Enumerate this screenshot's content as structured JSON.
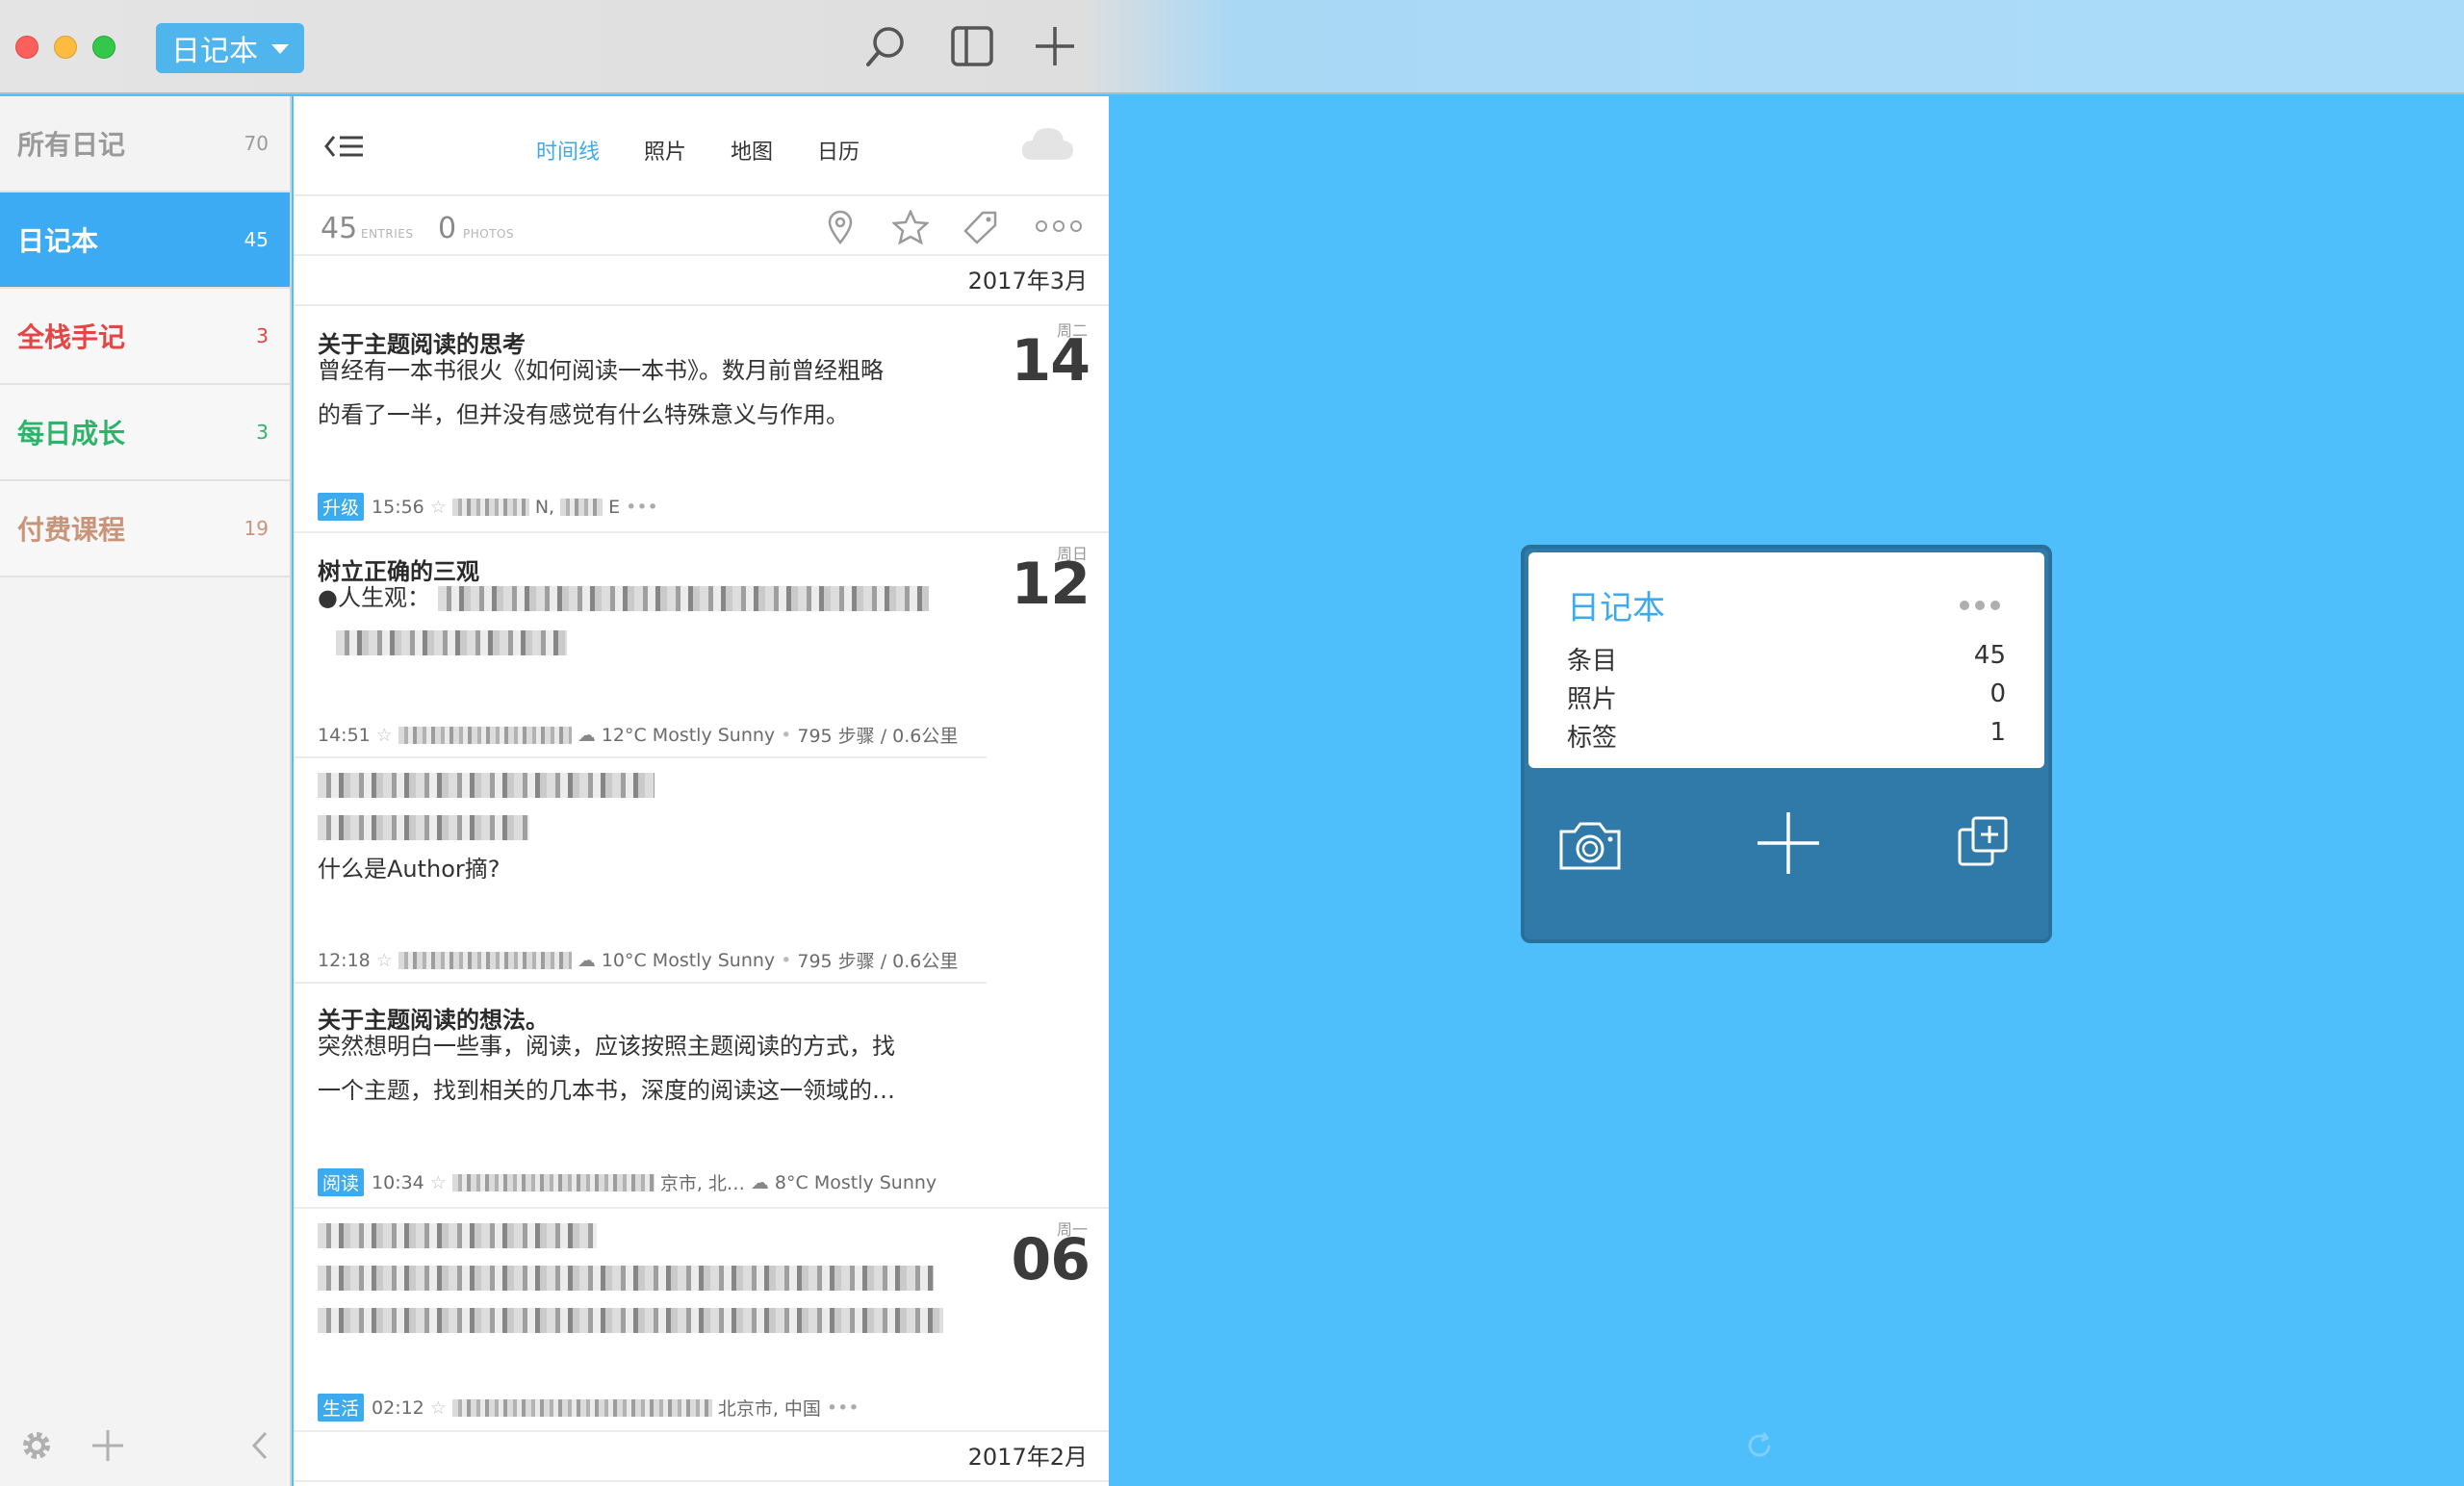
{
  "titlebar": {
    "journal_picker": "日记本",
    "icons": [
      "search-icon",
      "sidebar-toggle-icon",
      "add-icon"
    ]
  },
  "sidebar": {
    "items": [
      {
        "label": "所有日记",
        "count": "70",
        "color": "#9a9a9a"
      },
      {
        "label": "日记本",
        "count": "45",
        "color": "#3cabf3"
      },
      {
        "label": "全栈手记",
        "count": "3",
        "color": "#e54545"
      },
      {
        "label": "每日成长",
        "count": "3",
        "color": "#2fb36a"
      },
      {
        "label": "付费课程",
        "count": "19",
        "color": "#c9957a"
      }
    ],
    "footer_icons": [
      "gear-icon",
      "add-icon",
      "chevron-left-icon"
    ]
  },
  "list": {
    "tabs": [
      "时间线",
      "照片",
      "地图",
      "日历"
    ],
    "active_tab": "时间线",
    "stats": {
      "entries": "45",
      "entries_label": "ENTRIES",
      "photos": "0",
      "photos_label": "PHOTOS"
    },
    "filter_icons": [
      "location-pin-icon",
      "star-icon",
      "tag-icon",
      "more-icon"
    ],
    "month_top": "2017年3月",
    "month_bottom": "2017年2月",
    "entries": [
      {
        "title": "关于主题阅读的思考",
        "body1": "曾经有一本书很火《如何阅读一本书》。数月前曾经粗略",
        "body2": "的看了一半，但并没有感觉有什么特殊意义与作用。",
        "tag": "升级",
        "time": "15:56",
        "meta_tail": "N,",
        "meta_tail2": "E",
        "dow": "周二",
        "day": "14"
      },
      {
        "title": "树立正确的三观",
        "body1": "●人生观：",
        "time": "14:51",
        "weather": "12°C Mostly Sunny",
        "steps": "795 步骤 / 0.6公里",
        "dow": "周日",
        "day": "12"
      },
      {
        "body3": "什么是Author摘?",
        "time": "12:18",
        "weather": "10°C Mostly Sunny",
        "steps": "795 步骤 / 0.6公里"
      },
      {
        "title": "关于主题阅读的想法。",
        "body1": "突然想明白一些事，阅读，应该按照主题阅读的方式，找",
        "body2": "一个主题，找到相关的几本书，深度的阅读这一领域的…",
        "tag": "阅读",
        "time": "10:34",
        "location": "京市, 北…",
        "weather": "8°C Mostly Sunny"
      },
      {
        "tag": "生活",
        "time": "02:12",
        "location": "北京市, 中国",
        "dow": "周一",
        "day": "06"
      }
    ]
  },
  "widget": {
    "title": "日记本",
    "rows": [
      {
        "label": "条目",
        "value": "45"
      },
      {
        "label": "照片",
        "value": "0"
      },
      {
        "label": "标签",
        "value": "1"
      }
    ],
    "icons": [
      "camera-icon",
      "add-entry-icon",
      "duplicate-icon"
    ]
  },
  "colors": {
    "accent": "#3caaef",
    "background": "#4fbffc",
    "widget": "#2f7aa8"
  }
}
